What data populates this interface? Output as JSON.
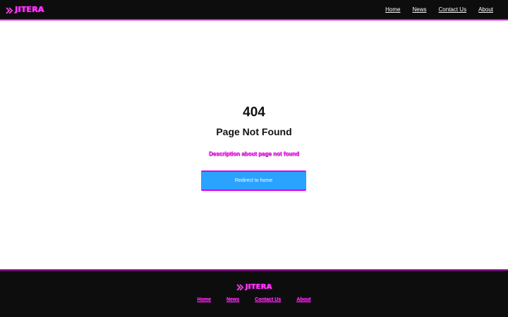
{
  "brand": {
    "name": "JITERA",
    "accent_color": "#ff33ee",
    "logo_icon": "double-chevron-icon"
  },
  "header": {
    "nav": [
      {
        "label": "Home"
      },
      {
        "label": "News"
      },
      {
        "label": "Contact Us"
      },
      {
        "label": "About"
      }
    ]
  },
  "main": {
    "code": "404",
    "title": "Page Not Found",
    "description": "Description about page not found",
    "button_label": "Redirect to home",
    "button_color": "#2aa3ff"
  },
  "footer": {
    "nav": [
      {
        "label": "Home"
      },
      {
        "label": "News"
      },
      {
        "label": "Contact Us"
      },
      {
        "label": "About"
      }
    ]
  }
}
